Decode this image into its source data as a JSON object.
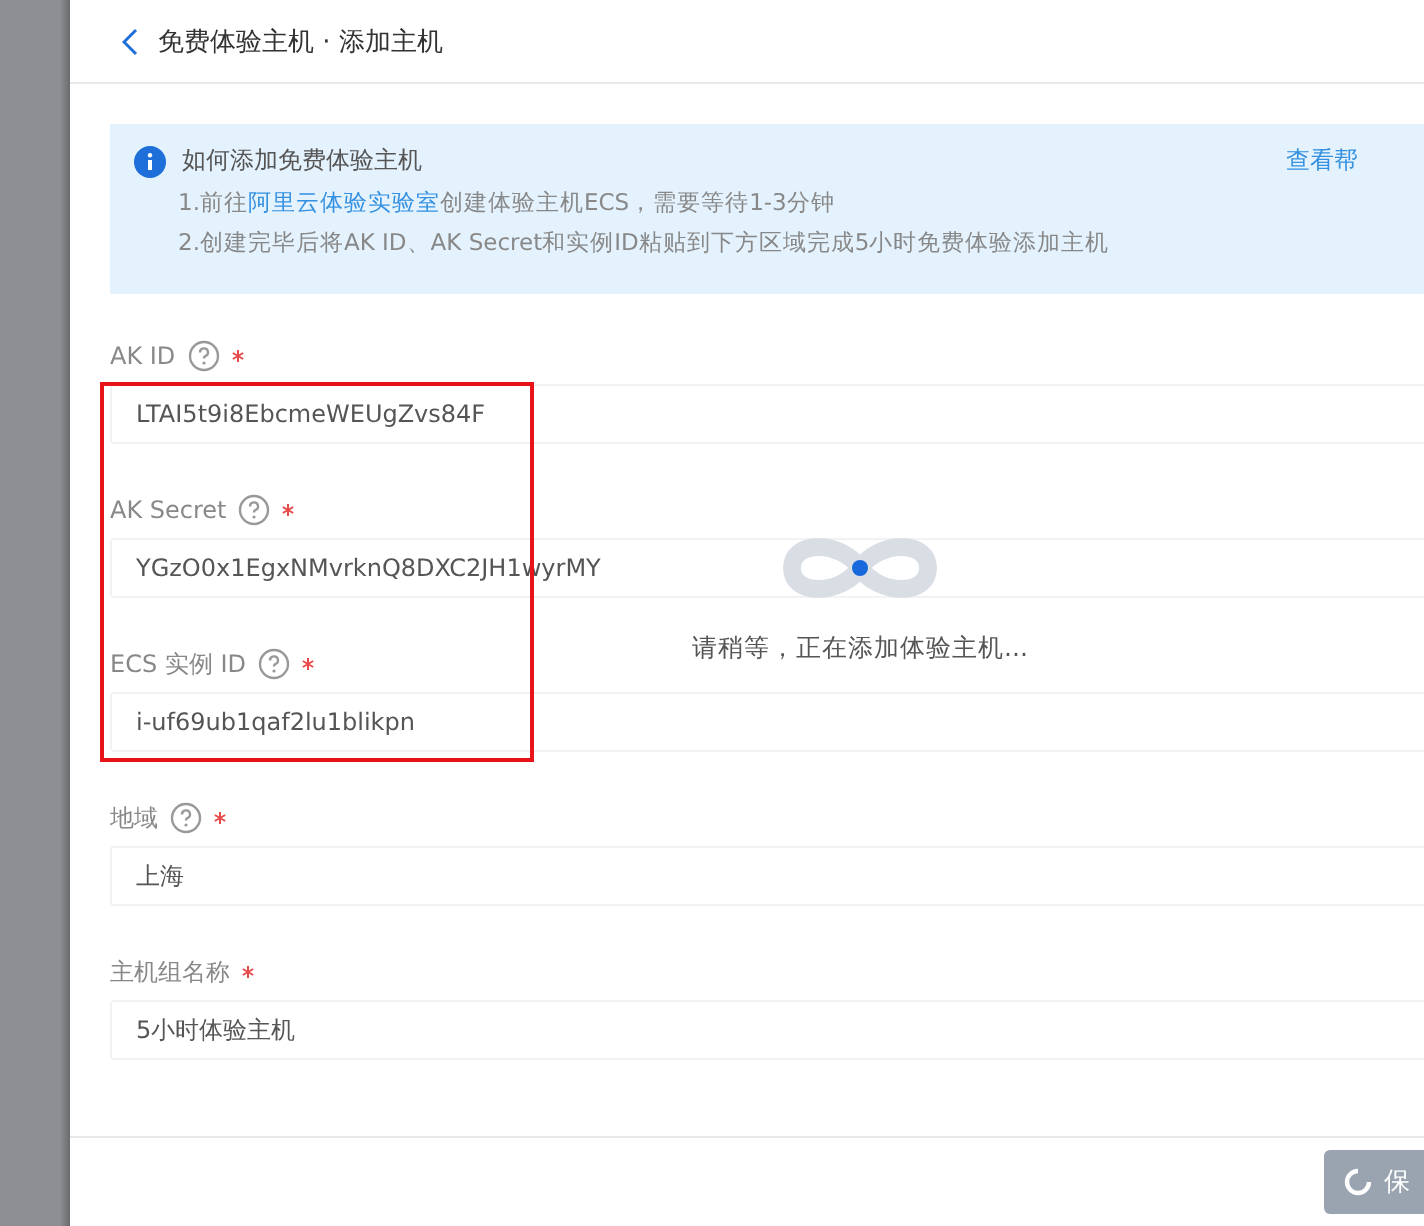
{
  "header": {
    "title": "免费体验主机 · 添加主机"
  },
  "info": {
    "title": "如何添加免费体验主机",
    "help_link": "查看帮",
    "lines": [
      {
        "before": "1.前往",
        "link": "阿里云体验实验室",
        "after": "创建体验主机ECS，需要等待1-3分钟"
      },
      {
        "before": "2.创建完毕后将AK ID、AK Secret和实例ID粘贴到下方区域完成5小时免费体验添加主机"
      }
    ]
  },
  "fields": [
    {
      "label": "AK ID",
      "help": true,
      "required": true,
      "value": "LTAI5t9i8EbcmeWEUgZvs84F",
      "highlighted": true
    },
    {
      "label": "AK Secret",
      "help": true,
      "required": true,
      "value": "YGzO0x1EgxNMvrknQ8DXC2JH1wyrMY",
      "highlighted": true
    },
    {
      "label": "ECS 实例 ID",
      "help": true,
      "required": true,
      "value": "i-uf69ub1qaf2lu1blikpn",
      "highlighted": true
    },
    {
      "label": "地域",
      "help": true,
      "required": true,
      "value": "上海",
      "highlighted": false
    },
    {
      "label": "主机组名称",
      "help": false,
      "required": true,
      "value": "5小时体验主机",
      "highlighted": false
    }
  ],
  "loading": {
    "text": "请稍等，正在添加体验主机..."
  },
  "footer": {
    "button": "保",
    "button_loading": true
  }
}
